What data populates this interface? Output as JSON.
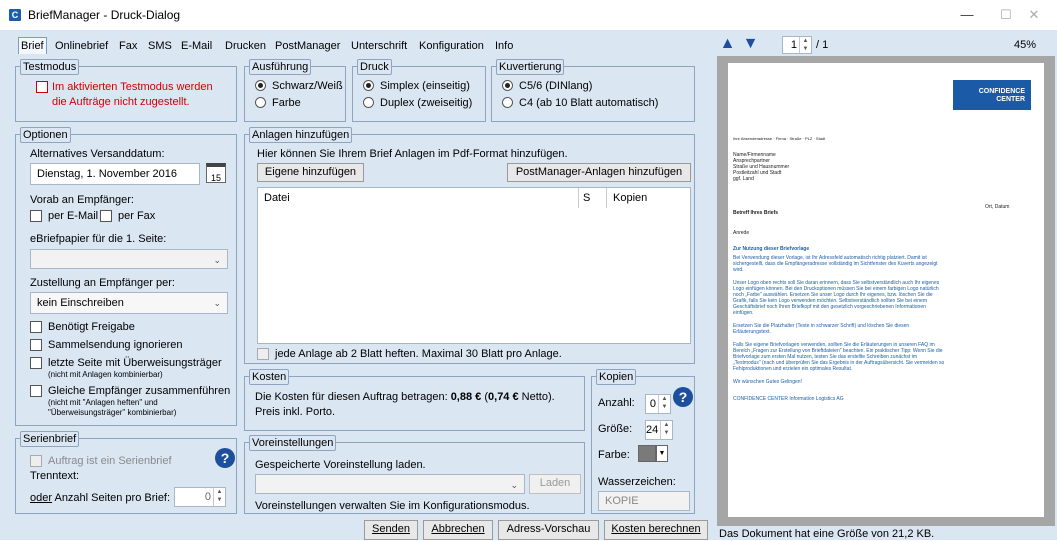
{
  "window": {
    "title": "BriefManager - Druck-Dialog",
    "app_icon": "C",
    "controls": [
      "—",
      "☐",
      "✕"
    ]
  },
  "menu": [
    "Brief",
    "Onlinebrief",
    "Fax",
    "SMS",
    "E-Mail",
    "Drucken",
    "PostManager",
    "Unterschrift",
    "Konfiguration",
    "Info"
  ],
  "testmodus": {
    "label": "Testmodus",
    "text_line1": "Im aktivierten Testmodus werden",
    "text_line2": "die Aufträge nicht zugestellt."
  },
  "ausfuehrung": {
    "label": "Ausführung",
    "opt1": "Schwarz/Weiß",
    "opt2": "Farbe"
  },
  "druck": {
    "label": "Druck",
    "opt1": "Simplex (einseitig)",
    "opt2": "Duplex (zweiseitig)"
  },
  "kuvertierung": {
    "label": "Kuvertierung",
    "opt1": "C5/6 (DINlang)",
    "opt2": "C4 (ab 10 Blatt automatisch)"
  },
  "optionen": {
    "label": "Optionen",
    "alt_date_label": "Alternatives Versanddatum:",
    "date_value": "Dienstag, 1. November 2016",
    "calendar_day": "15",
    "vorab_label": "Vorab an Empfänger:",
    "per_email": "per E-Mail",
    "per_fax": "per Fax",
    "ebrief_label": "eBriefpapier für die 1. Seite:",
    "zustellung_label": "Zustellung an Empfänger per:",
    "zustellung_value": "kein Einschreiben",
    "freigabe": "Benötigt Freigabe",
    "sammel": "Sammelsendung ignorieren",
    "letzte_seite": "letzte Seite mit Überweisungsträger",
    "letzte_seite_note": "(nicht mit Anlagen kombinierbar)",
    "gleiche": "Gleiche Empfänger zusammenführen",
    "gleiche_note1": "(nicht mit \"Anlagen heften\" und",
    "gleiche_note2": "\"Überweisungsträger\" kombinierbar)"
  },
  "anlagen": {
    "label": "Anlagen hinzufügen",
    "info": "Hier können Sie Ihrem Brief Anlagen im Pdf-Format hinzufügen.",
    "btn_own": "Eigene hinzufügen",
    "btn_pm": "PostManager-Anlagen hinzufügen",
    "col_file": "Datei",
    "col_s": "S",
    "col_copies": "Kopien",
    "staple": "jede Anlage ab 2 Blatt heften. Maximal 30 Blatt pro Anlage."
  },
  "kosten": {
    "label": "Kosten",
    "line1_pre": "Die Kosten für diesen Auftrag betragen: ",
    "brutto": "0,88 €",
    "open_paren": " (",
    "netto": "0,74 €",
    "line1_post": " Netto).",
    "line2": "Preis inkl. Porto."
  },
  "kopien": {
    "label": "Kopien",
    "anzahl_label": "Anzahl:",
    "anzahl_value": "0",
    "groesse_label": "Größe:",
    "groesse_value": "24",
    "farbe_label": "Farbe:",
    "wasserzeichen_label": "Wasserzeichen:",
    "wasserzeichen_value": "KOPIE"
  },
  "serienbrief": {
    "label": "Serienbrief",
    "checkbox": "Auftrag ist ein Serienbrief",
    "trenntext": "Trenntext:",
    "oder": "oder",
    "anzahl": " Anzahl Seiten pro Brief:",
    "anzahl_value": "0"
  },
  "voreinstellungen": {
    "label": "Voreinstellungen",
    "load_label": "Gespeicherte Voreinstellung laden.",
    "btn_load": "Laden",
    "manage": "Voreinstellungen verwalten Sie im Konfigurationsmodus."
  },
  "footer": {
    "senden": "Senden",
    "abbrechen": "Abbrechen",
    "adress": "Adress-Vorschau",
    "kosten": "Kosten berechnen"
  },
  "preview": {
    "page_value": "1",
    "page_total": "/ 1",
    "zoom": "45%",
    "size_text": "Das Dokument hat eine Größe von 21,2 KB.",
    "logo_line1": "CONFIDENCE",
    "logo_line2": "CENTER",
    "sender": "Ihre Absenderadresse · Firma · Straße · PLZ · Stadt",
    "addr1": "Name/Firmenname",
    "addr2": "Ansprechpartner",
    "addr3": "Straße und Hausnummer",
    "addr4": "Postleitzahl und Stadt",
    "addr5": "ggf. Land",
    "date": "Ort, Datum",
    "subject": "Betreff Ihres Briefs",
    "anrede": "Anrede",
    "heading": "Zur Nutzung dieser Briefvorlage",
    "p1a": "Bei Verwendung dieser Vorlage, ist Ihr Adressfeld automatisch richtig platziert. Damit ist",
    "p1b": "sichergestellt, dass die Empfängeradresse vollständig im Sichtfenster des Kuverts angezeigt",
    "p1c": "wird.",
    "p2a": "Unser Logo oben rechts soll Sie daran erinnern, dass Sie selbstverständlich auch Ihr eigenes",
    "p2b": "Logo einfügen können. Bei den Druckoptionen müssen Sie bei einem farbigen Logo natürlich",
    "p2c": "noch „Farbe\" auswählen. Ersetzen Sie unser Logo durch Ihr eigenes, bzw. löschen Sie die",
    "p2d": "Grafik, falls Sie kein Logo verwenden möchten. Selbstverständlich sollten Sie bei einem",
    "p2e": "Geschäftsbrief noch Ihren Briefkopf mit den gesetzlich vorgeschriebenen Informationen",
    "p2f": "einfügen.",
    "p3a": "Ersetzen Sie die Platzhalter (Texte in schwarzer Schrift) und löschen Sie diesen",
    "p3b": "Erläuterungstext.",
    "p4a": "Falls Sie eigene Briefvorlagen verwenden, sollten Sie die Erläuterungen in unseren FAQ im",
    "p4b": "Bereich „Fragen zur Erstellung von Brieftdateien\" beachten. Ein praktischer Tipp: Wenn Sie die",
    "p4c": "Briefvorlage zum ersten Mal nutzen, testen Sie das erstellte Schreiben zunächst im",
    "p4d": "„Testmodus\" (nach und überprüfen Sie das Ergebnis in der Auftragsübersicht. Sie vermeiden so",
    "p4e": "Fehlproduktionen und erzielen ein optimales Resultat.",
    "closing": "Wir wünschen Gutes Gelingen!",
    "signature": "CONFIDENCE CENTER Information Logistics AG"
  },
  "colors": {
    "panel_bg": "#dbe6f3",
    "accent": "#1e4f9c",
    "warning": "#d00000"
  }
}
